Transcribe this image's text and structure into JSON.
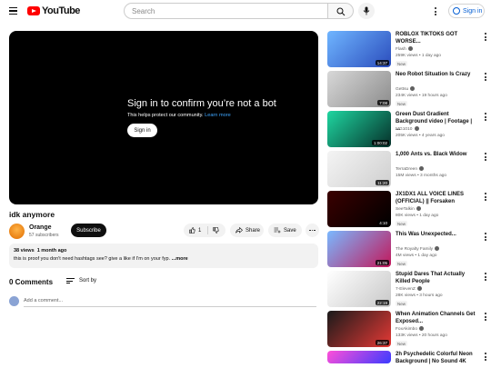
{
  "header": {
    "logo_text": "YouTube",
    "search_placeholder": "Search",
    "sign_in_label": "Sign in"
  },
  "player": {
    "title": "Sign in to confirm you’re not a bot",
    "subtitle": "This helps protect our community.",
    "learn_more": "Learn more",
    "sign_in_button": "Sign in"
  },
  "video": {
    "title": "idk anymore",
    "channel": "Orange",
    "subscribers": "57 subscribers",
    "subscribe_label": "Subscribe",
    "likes": "1",
    "share_label": "Share",
    "save_label": "Save",
    "views": "38 views",
    "age": "1 month ago",
    "description": "this is proof you don't need hashtags see? give a like if I'm on your fyp.",
    "more_label": "...more"
  },
  "comments": {
    "count_label": "0 Comments",
    "sort_label": "Sort by",
    "add_placeholder": "Add a comment..."
  },
  "sidebar": [
    {
      "title": "ROBLOX TIKTOKS GOT WORSE...",
      "channel": "Flash",
      "views": "259K views",
      "age": "1 day ago",
      "badge": "New",
      "duration": "14:37",
      "colors": [
        "#6fb5ff",
        "#2b4dbd"
      ]
    },
    {
      "title": "Neo Robot Situation Is Crazy",
      "channel": "Gettsu",
      "views": "234K views",
      "age": "19 hours ago",
      "badge": "New",
      "duration": "7:08",
      "colors": [
        "#d8d8d8",
        "#8c8c8c"
      ]
    },
    {
      "title": "Green Dust Gradient Background video | Footage | ...",
      "channel": "MG1010",
      "views": "205K views",
      "age": "4 years ago",
      "badge": "",
      "duration": "1:00:02",
      "colors": [
        "#1fd6a0",
        "#06302a"
      ]
    },
    {
      "title": "1,000 Ants vs. Black Widow",
      "channel": "TerraDreen",
      "views": "15M views",
      "age": "3 months ago",
      "badge": "",
      "duration": "11:20",
      "colors": [
        "#f4f4f4",
        "#cfcfcf"
      ]
    },
    {
      "title": "JX1DX1 ALL VOICE LINES (OFFICIAL) || Forsaken",
      "channel": "SeeTalkin",
      "views": "80K views",
      "age": "1 day ago",
      "badge": "New",
      "duration": "4:10",
      "colors": [
        "#3a0000",
        "#000000"
      ]
    },
    {
      "title": "This Was Unexpected...",
      "channel": "The Royalty Family",
      "views": "4M views",
      "age": "1 day ago",
      "badge": "New",
      "duration": "21:05",
      "colors": [
        "#7ab8ff",
        "#c2185b"
      ]
    },
    {
      "title": "Stupid Dares That Actually Killed People",
      "channel": "7-ElevenZ",
      "views": "28K views",
      "age": "3 hours ago",
      "badge": "New",
      "duration": "22:19",
      "colors": [
        "#ffffff",
        "#c8c8c8"
      ]
    },
    {
      "title": "When Animation Channels Get Exposed...",
      "channel": "FoxAkimbo",
      "views": "133K views",
      "age": "20 hours ago",
      "badge": "New",
      "duration": "26:37",
      "colors": [
        "#1a1a1a",
        "#e53935"
      ]
    },
    {
      "title": "2h Psychedelic Colorful Neon Background | No Sound 4K",
      "channel": "",
      "views": "",
      "age": "",
      "badge": "",
      "duration": "",
      "colors": [
        "#ff4fd8",
        "#3b3bff"
      ]
    }
  ]
}
